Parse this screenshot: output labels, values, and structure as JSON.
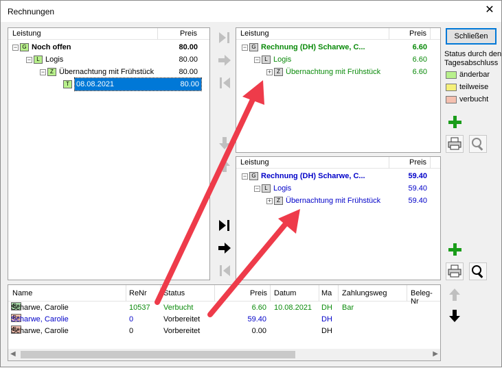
{
  "window": {
    "title": "Rechnungen",
    "close_glyph": "✕"
  },
  "left_tree": {
    "col_leistung": "Leistung",
    "col_preis": "Preis",
    "rows": [
      {
        "badge": "G",
        "label": "Noch offen",
        "price": "80.00"
      },
      {
        "badge": "L",
        "label": "Logis",
        "price": "80.00"
      },
      {
        "badge": "Z",
        "label": "Übernachtung mit Frühstück",
        "price": "80.00"
      },
      {
        "badge": "T",
        "label": "08.08.2021",
        "price": "80.00"
      }
    ]
  },
  "invoice_top": {
    "col_leistung": "Leistung",
    "col_preis": "Preis",
    "color": "#0a8a0a",
    "rows": [
      {
        "badge": "G",
        "label": "Rechnung (DH) Scharwe, C...",
        "price": "6.60"
      },
      {
        "badge": "L",
        "label": "Logis",
        "price": "6.60"
      },
      {
        "badge": "Z",
        "label": "Übernachtung mit Frühstück",
        "price": "6.60"
      }
    ]
  },
  "invoice_bottom": {
    "col_leistung": "Leistung",
    "col_preis": "Preis",
    "color": "#0000c8",
    "rows": [
      {
        "badge": "G",
        "label": "Rechnung (DH) Scharwe, C...",
        "price": "59.40"
      },
      {
        "badge": "L",
        "label": "Logis",
        "price": "59.40"
      },
      {
        "badge": "Z",
        "label": "Übernachtung mit Frühstück",
        "price": "59.40"
      }
    ]
  },
  "sidebar": {
    "close_button": "Schließen",
    "status_heading": "Status durch den Tagesabschluss",
    "legend": [
      {
        "label": "änderbar",
        "color": "#b8f08c"
      },
      {
        "label": "teilweise",
        "color": "#f5f07a"
      },
      {
        "label": "verbucht",
        "color": "#f4c0b0"
      }
    ]
  },
  "table": {
    "headers": [
      "Name",
      "ReNr",
      "Status",
      "Preis",
      "Datum",
      "Ma",
      "Zahlungsweg",
      "Beleg-Nr"
    ],
    "rows": [
      {
        "icon": "Re",
        "name": "Scharwe, Carolie",
        "renr": "10537",
        "status": "Verbucht",
        "preis": "6.60",
        "datum": "10.08.2021",
        "ma": "DH",
        "zahlungsweg": "Bar",
        "color": "#0a8a0a"
      },
      {
        "icon": "Re",
        "name": "Scharwe, Carolie",
        "renr": "0",
        "status": "Vorbereitet",
        "preis": "59.40",
        "datum": "",
        "ma": "DH",
        "zahlungsweg": "",
        "color": "#0000c8"
      },
      {
        "icon": "Re",
        "name": "Scharwe, Carolie",
        "renr": "0",
        "status": "Vorbereitet",
        "preis": "0.00",
        "datum": "",
        "ma": "DH",
        "zahlungsweg": "",
        "color": "#000000"
      }
    ]
  },
  "colors": {
    "selection": "#0078d7",
    "annotation_arrow": "#ee3b4a"
  }
}
